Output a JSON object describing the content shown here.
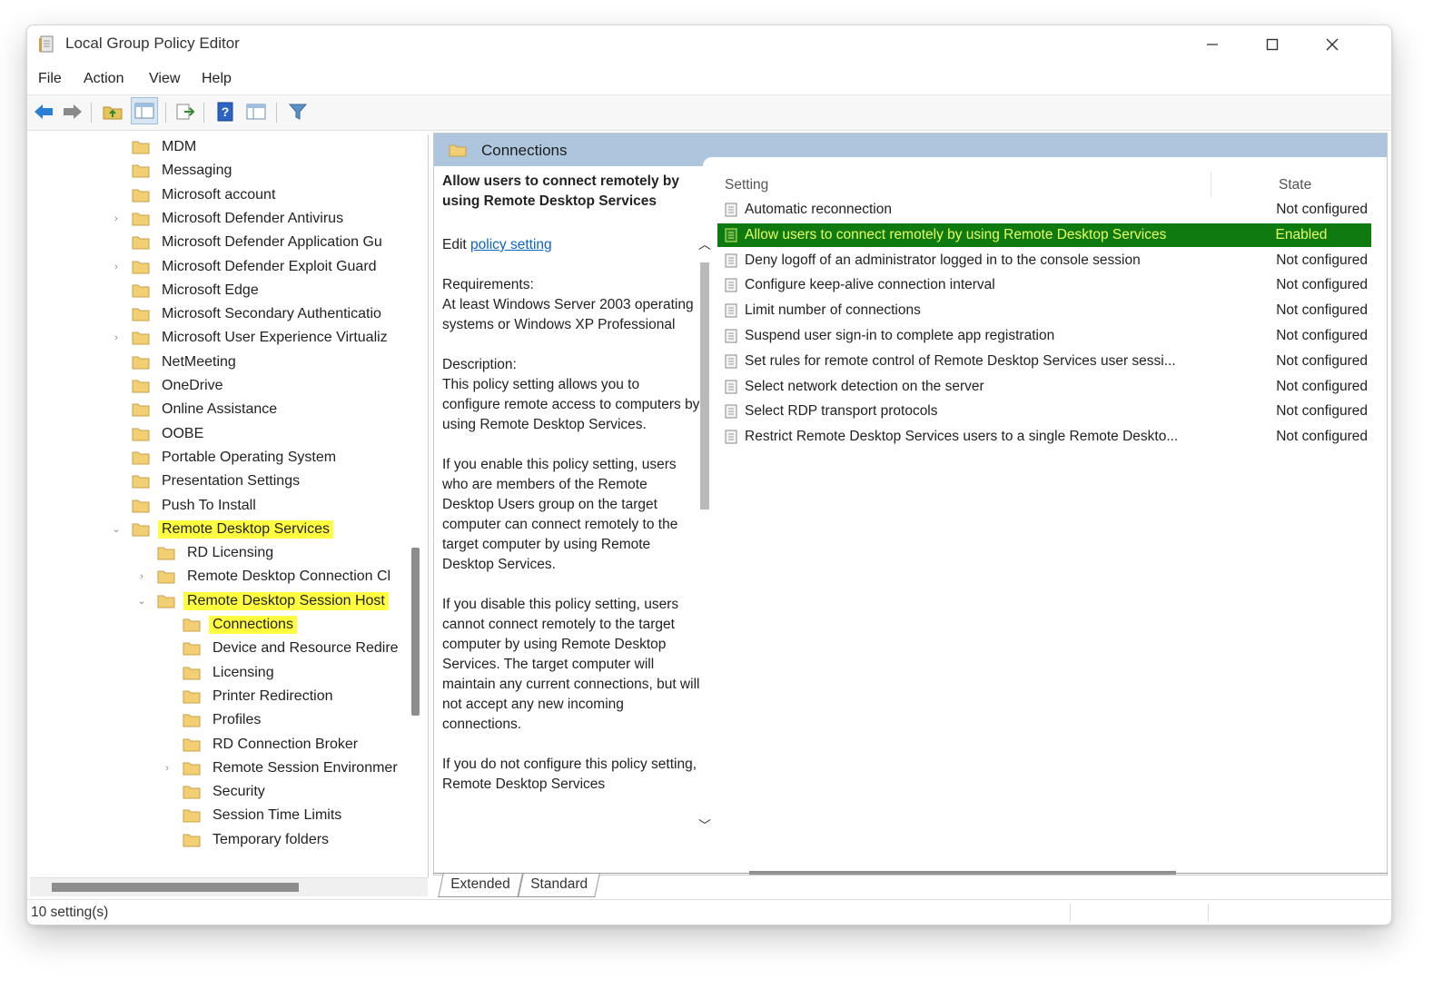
{
  "window": {
    "title": "Local Group Policy Editor",
    "controls": {
      "minimize": "—",
      "maximize": "☐",
      "close": "✕"
    }
  },
  "menubar": {
    "items": [
      "File",
      "Action",
      "View",
      "Help"
    ]
  },
  "toolbar": {
    "buttons": [
      "back-icon",
      "forward-icon",
      "up-folder-icon",
      "show-hide-tree-icon",
      "export-list-icon",
      "help-icon",
      "properties-icon",
      "filter-icon"
    ]
  },
  "tree": {
    "items": [
      {
        "label": "MDM",
        "expander": "",
        "highlighted": false
      },
      {
        "label": "Messaging",
        "expander": "",
        "highlighted": false
      },
      {
        "label": "Microsoft account",
        "expander": "",
        "highlighted": false
      },
      {
        "label": "Microsoft Defender Antivirus",
        "expander": "›",
        "highlighted": false
      },
      {
        "label": "Microsoft Defender Application Gu",
        "expander": "",
        "highlighted": false
      },
      {
        "label": "Microsoft Defender Exploit Guard",
        "expander": "›",
        "highlighted": false
      },
      {
        "label": "Microsoft Edge",
        "expander": "",
        "highlighted": false
      },
      {
        "label": "Microsoft Secondary Authenticatio",
        "expander": "",
        "highlighted": false
      },
      {
        "label": "Microsoft User Experience Virtualiz",
        "expander": "›",
        "highlighted": false
      },
      {
        "label": "NetMeeting",
        "expander": "",
        "highlighted": false
      },
      {
        "label": "OneDrive",
        "expander": "",
        "highlighted": false
      },
      {
        "label": "Online Assistance",
        "expander": "",
        "highlighted": false
      },
      {
        "label": "OOBE",
        "expander": "",
        "highlighted": false
      },
      {
        "label": "Portable Operating System",
        "expander": "",
        "highlighted": false
      },
      {
        "label": "Presentation Settings",
        "expander": "",
        "highlighted": false
      },
      {
        "label": "Push To Install",
        "expander": "",
        "highlighted": false
      },
      {
        "label": "Remote Desktop Services",
        "expander": "⌄",
        "highlighted": true
      },
      {
        "label": "RD Licensing",
        "expander": "",
        "highlighted": false
      },
      {
        "label": "Remote Desktop Connection Cl",
        "expander": "›",
        "highlighted": false
      },
      {
        "label": "Remote Desktop Session Host",
        "expander": "⌄",
        "highlighted": true
      },
      {
        "label": "Connections",
        "expander": "",
        "highlighted": true
      },
      {
        "label": "Device and Resource Redire",
        "expander": "",
        "highlighted": false
      },
      {
        "label": "Licensing",
        "expander": "",
        "highlighted": false
      },
      {
        "label": "Printer Redirection",
        "expander": "",
        "highlighted": false
      },
      {
        "label": "Profiles",
        "expander": "",
        "highlighted": false
      },
      {
        "label": "RD Connection Broker",
        "expander": "",
        "highlighted": false
      },
      {
        "label": "Remote Session Environmer",
        "expander": "›",
        "highlighted": false
      },
      {
        "label": "Security",
        "expander": "",
        "highlighted": false
      },
      {
        "label": "Session Time Limits",
        "expander": "",
        "highlighted": false
      },
      {
        "label": "Temporary folders",
        "expander": "",
        "highlighted": false
      }
    ]
  },
  "pane": {
    "header": "Connections",
    "description": {
      "title": "Allow users to connect remotely by using Remote Desktop Services",
      "edit_prefix": "Edit",
      "edit_link": "policy setting",
      "requirements_label": "Requirements:",
      "requirements": "At least Windows Server 2003 operating systems or Windows XP Professional",
      "description_label": "Description:",
      "description": "This policy setting allows you to configure remote access to computers by using Remote Desktop Services.",
      "enable_text": "If you enable this policy setting, users who are members of the Remote Desktop Users group on the target computer can connect remotely to the target computer by using Remote Desktop Services.",
      "disable_text": "If you disable this policy setting, users cannot connect remotely to the target computer by using Remote Desktop Services. The target computer will maintain any current connections, but will not accept any new incoming connections.",
      "notconfig_text": "If you do not configure this policy setting, Remote Desktop Services"
    },
    "list": {
      "columns": {
        "setting": "Setting",
        "state": "State"
      },
      "rows": [
        {
          "name": "Automatic reconnection",
          "state": "Not configured",
          "selected": false
        },
        {
          "name": "Allow users to connect remotely by using Remote Desktop Services",
          "state": "Enabled",
          "selected": true
        },
        {
          "name": "Deny logoff of an administrator logged in to the console session",
          "state": "Not configured",
          "selected": false
        },
        {
          "name": "Configure keep-alive connection interval",
          "state": "Not configured",
          "selected": false
        },
        {
          "name": "Limit number of connections",
          "state": "Not configured",
          "selected": false
        },
        {
          "name": "Suspend user sign-in to complete app registration",
          "state": "Not configured",
          "selected": false
        },
        {
          "name": "Set rules for remote control of Remote Desktop Services user sessi...",
          "state": "Not configured",
          "selected": false
        },
        {
          "name": "Select network detection on the server",
          "state": "Not configured",
          "selected": false
        },
        {
          "name": "Select RDP transport protocols",
          "state": "Not configured",
          "selected": false
        },
        {
          "name": "Restrict Remote Desktop Services users to a single Remote Deskto...",
          "state": "Not configured",
          "selected": false
        }
      ]
    },
    "tabs": [
      "Extended",
      "Standard"
    ]
  },
  "statusbar": {
    "text": "10 setting(s)"
  },
  "colors": {
    "tree_highlight": "#ffff40",
    "selected_row_bg": "#0f7a0f",
    "selected_row_text": "#e6ff66",
    "pane_header_bg": "#adc6de",
    "folder": "#f2cf73",
    "link": "#0b64c8"
  }
}
